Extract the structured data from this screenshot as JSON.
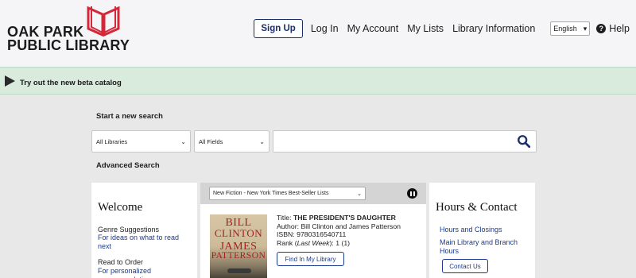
{
  "header": {
    "logo": {
      "line1": "OAK PARK",
      "line2": "PUBLIC LIBRARY",
      "accent_color": "#d4283a"
    },
    "nav": {
      "signup_label": "Sign Up",
      "login_label": "Log In",
      "account_label": "My Account",
      "lists_label": "My Lists",
      "info_label": "Library Information",
      "language": "English",
      "help_label": "Help"
    }
  },
  "banner": {
    "text": "Try out the new beta catalog",
    "background": "#d8ebdd"
  },
  "search": {
    "heading": "Start a new search",
    "library_select": "All Libraries",
    "field_select": "All Fields",
    "query": "",
    "search_icon": "search-icon",
    "advanced_label": "Advanced Search"
  },
  "welcome": {
    "title": "Welcome",
    "sections": [
      {
        "label": "Genre Suggestions",
        "link": "For ideas on what to read next"
      },
      {
        "label": "Read to Order",
        "link": "For personalized recommendations"
      }
    ]
  },
  "carousel": {
    "list_select": "New Fiction - New York Times Best-Seller Lists",
    "cover": {
      "author_line1": "BILL",
      "author_line2": "CLINTON",
      "author_line3": "JAMES",
      "author_line4": "PATTERSON"
    },
    "book": {
      "title_label": "Title:",
      "title": "THE PRESIDENT'S DAUGHTER",
      "author_label": "Author:",
      "author": "Bill Clinton and James Patterson",
      "isbn_label": "ISBN:",
      "isbn": "9780316540711",
      "rank_label": "Rank (",
      "rank_italic": "Last Week",
      "rank_value": "): 1 (1)"
    },
    "find_label": "Find In My Library"
  },
  "hours": {
    "title": "Hours & Contact",
    "links": [
      "Hours and Closings",
      "Main Library and Branch Hours"
    ],
    "contact_label": "Contact Us"
  },
  "colors": {
    "link": "#1b3a8f",
    "brand_navy": "#1b2f6b"
  }
}
